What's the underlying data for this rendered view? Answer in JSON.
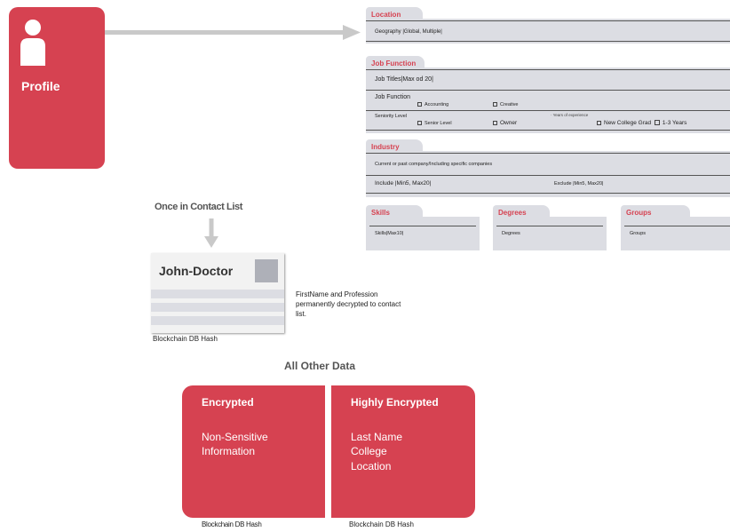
{
  "profile": {
    "label": "Profile"
  },
  "location": {
    "tab": "Location",
    "field": "Geography |Global, Multiple|"
  },
  "job_function": {
    "tab": "Job Function",
    "job_titles": "Job Titles|Max od 20|",
    "job_function_label": "Job Function",
    "options": [
      "Accounting",
      "Creative"
    ],
    "seniority_label": "Seniority Level",
    "years_label": "Years of experience",
    "seniority_options": [
      "Senior Level",
      "Owner",
      "New College Grad",
      "1-3 Years"
    ]
  },
  "industry": {
    "tab": "Industry",
    "current": "Current or past company/Including specific companies",
    "include": "Include |Min5, Max20|",
    "exclude": "Exclude |Min5, Max20|"
  },
  "skills": {
    "tab": "Skills",
    "field": "Skills|Max10|"
  },
  "degrees": {
    "tab": "Degrees",
    "field": "Degrees"
  },
  "groups": {
    "tab": "Groups",
    "field": "Groups"
  },
  "contact": {
    "heading": "Once in Contact List",
    "card_name": "John-Doctor",
    "note": "FirstName and Profession permanently decrypted to contact list.",
    "hash": "Blockchain DB Hash"
  },
  "other": {
    "heading": "All Other Data",
    "encrypted": {
      "title": "Encrypted",
      "body_lines": [
        "Non-Sensitive",
        "Information"
      ],
      "hash": "Blockchain DB Hash"
    },
    "highly": {
      "title": "Highly Encrypted",
      "body_lines": [
        "Last Name",
        "College",
        "Location"
      ],
      "hash": "Blockchain DB Hash"
    }
  },
  "colors": {
    "accent": "#d64251",
    "panel": "#dcdde3",
    "arrow": "#c9c9c9"
  }
}
